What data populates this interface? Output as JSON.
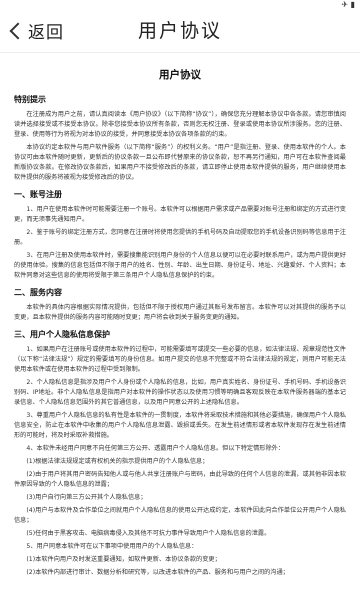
{
  "status_bar": {
    "icons": "✈ ▮"
  },
  "nav": {
    "back_label": "返回",
    "title": "用户协议"
  },
  "doc": {
    "title": "用户协议",
    "sections": [
      {
        "heading": "特别提示",
        "paragraphs": [
          "在注册成为用户之前，请认真阅读本《用户协议》（以下简称“协议”），确保您充分理解本协议中各条款。请您审慎阅读并选择接受或不接受本协议。除非您接受本协议所有条款，否则您无权注册、登录或使用本协议所涉服务。您的注册、登录、使用等行为将视为对本协议的接受，并同意接受本协议各项条款的约束。",
          "本协议约定本软件与用户软件服务（以下简称“服务”）的权利义务。“用户”是指注册、登录、使用本软件的个人。本协议可由本软件随时更新，更新后的协议条款一旦公布即代替原来的协议条款，恕不再另行通知，用户可在本软件查阅最新版协议条款。在修改协议条款后，如果用户不接受修改后的条款，请立即停止使用本软件提供的服务，用户继续使用本软件提供的服务将被视为接受修改后的协议。"
        ]
      },
      {
        "heading": "一、账号注册",
        "paragraphs": [
          "1、用户在使用本软件时可能需要注册一个账号。本软件可以根据用户需求或产品需要对账号注册和绑定的方式进行变更，而无须事先通知用户。",
          "2、鉴于账号的绑定注册方式，您同意在注册时将使用您提供的手机号码及自动提取您的手机设备识别码等信息用于注册。",
          "3、在用户注册及使用本软件时，需要搜集能识别用户身份的个人信息以便可以在必要时联系用户，或为用户提供更好的使用体验。搜集的信息包括但不限于用户的姓名、性别、年龄、出生日期、身份证号、地址、兴趣爱好、个人资料；本软件同意对这些信息的使用将受限于第三条用户个人隐私信息保护的约束。"
        ]
      },
      {
        "heading": "二、服务内容",
        "paragraphs": [
          "本软件的具体内容根据实际情况提供，包括但不限于授权用户通过其账号发布留言。本软件可以对其提供的服务予以变更，且本软件提供的服务内容可能随时变更；用户将会收到关于服务变更的通知。"
        ]
      },
      {
        "heading": "三、用户个人隐私信息保护",
        "paragraphs": [
          "1、如果用户在注册账号或使用本软件的过程中，可能需要填写或提交一些必要的信息，如法律法规、规章规范性文件（以下称“法律法规”）规定的需要填写的身份信息。如用户提交的信息不完整或不符合法律法规的规定，则用户可能无法使用本软件或在使用本软件的过程中受到限制。",
          "2、个人隐私信息是指涉及用户个人身份或个人隐私的信息，比如，用户真实姓名、身份证号、手机号码、手机设备识别码、IP地址。非个人隐私信息是指用户对本软件的操作状态以及使用习惯等明确且客观反映在本软件服务器端的基本记录信息、个人隐私信息范围外的其它普通信息，以及用户同意公开的上述隐私信息。",
          "3、尊重用户个人隐私信息的私有性是本软件的一贯制度，本软件将采取技术措施和其他必要措施，确保用户个人隐私信息安全，防止在本软件中收集的用户个人隐私信息泄露、毁损或丢失。在发生前述情形或者本软件发现存在发生前述情形的可能时，将及时采取补救措施。",
          "4、本软件未经用户同意不向任何第三方公开、透露用户个人隐私信息。但以下特定情形除外：",
          "(1)根据法律法规规定或有权机关的指示提供用户的个人隐私信息；",
          "(2)由于用户将其用户密码告知他人或与他人共享注册账户与密码，由此导致的任何个人信息的泄漏，或其他非因本软件原因导致的个人隐私信息的泄露；",
          "(3)用户自行向第三方公开其个人隐私信息；",
          "(4)用户与本软件及合作单位之间就用户个人隐私信息的使用公开达成约定，本软件因此向合作单位公开用户个人隐私信息；",
          "(5)任何由于黑客攻击、电脑病毒侵入及其他不可抗力事件导致用户个人隐私信息的泄露。",
          "5、用户同意本软件可在以下事项中使用用户的个人隐私信息：",
          "(1)本软件向用户及时发送重要通知，如软件更新、本协议条款的变更；",
          "(2)本软件内部进行审计、数据分析和研究等，以改进本软件的产品、服务和与用户之间的沟通；"
        ]
      }
    ]
  }
}
